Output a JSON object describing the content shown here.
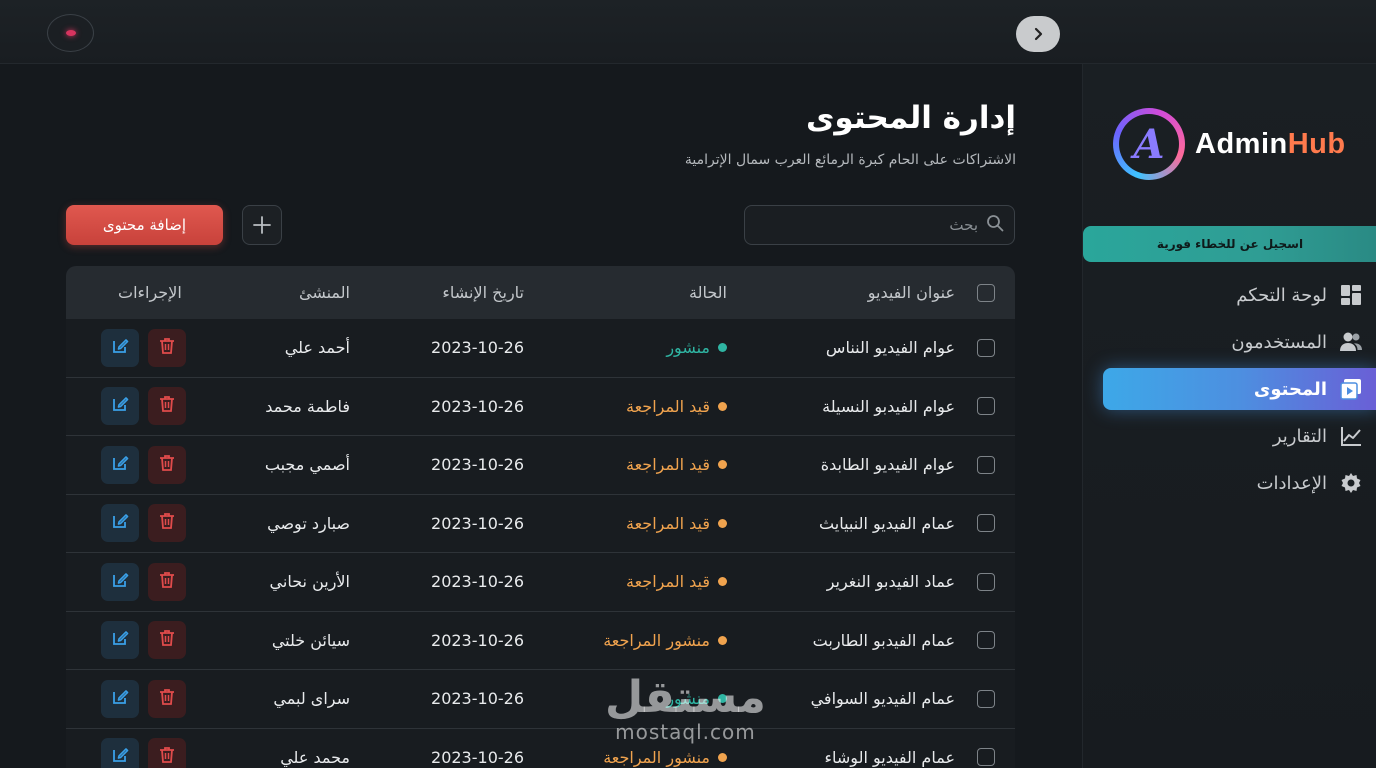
{
  "topbar": {
    "collapse_icon": "chevron-right-icon",
    "user_icon": "user-chip-icon"
  },
  "sidebar": {
    "logo": {
      "mark": "A",
      "text_primary": "Admin",
      "text_accent": "Hub"
    },
    "promo_text": "اسجيل عن للخطاء فورية",
    "items": [
      {
        "label": "لوحة التحكم",
        "icon": "dashboard-icon",
        "active": false
      },
      {
        "label": "المستخدمون",
        "icon": "users-icon",
        "active": false
      },
      {
        "label": "المحتوى",
        "icon": "video-icon",
        "active": true
      },
      {
        "label": "التقارير",
        "icon": "chart-icon",
        "active": false
      },
      {
        "label": "الإعدادات",
        "icon": "gear-icon",
        "active": false
      }
    ]
  },
  "main": {
    "title": "إدارة المحتوى",
    "subtitle": "الاشتراكات على الحام كبرة الرمائع العرب سمال الإترامية",
    "search_placeholder": "بحث",
    "add_button_label": "إضافة محتوى",
    "table": {
      "headers": {
        "title": "عنوان الفيديو",
        "status": "الحالة",
        "date": "تاريخ الإنشاء",
        "creator": "المنشئ",
        "actions": "الإجراءات"
      },
      "rows": [
        {
          "title": "عوام الفيديو النناس",
          "status": "منشور",
          "status_type": "published",
          "date": "2023-10-26",
          "creator": "أحمد علي"
        },
        {
          "title": "عوام الفيدبو النسيلة",
          "status": "قيد المراجعة",
          "status_type": "review",
          "date": "2023-10-26",
          "creator": "فاطمة محمد"
        },
        {
          "title": "عوام الفيديو الطابدة",
          "status": "قيد المراجعة",
          "status_type": "review",
          "date": "2023-10-26",
          "creator": "أصمي مجبب"
        },
        {
          "title": "عمام الفيديو النبيايث",
          "status": "قيد المراجعة",
          "status_type": "review",
          "date": "2023-10-26",
          "creator": "صبارد توصي"
        },
        {
          "title": "عماد الفيدبو النغرير",
          "status": "قيد المراجعة",
          "status_type": "review",
          "date": "2023-10-26",
          "creator": "الأرين نحاني"
        },
        {
          "title": "عمام الفيدبو الطاربت",
          "status": "منشور المراجعة",
          "status_type": "review",
          "date": "2023-10-26",
          "creator": "سيائن خلتي"
        },
        {
          "title": "عمام الفيديو السوافي",
          "status": "منشور",
          "status_type": "published",
          "date": "2023-10-26",
          "creator": "سراى لبمي"
        },
        {
          "title": "عمام الفيديو الوشاء",
          "status": "منشور المراجعة",
          "status_type": "review",
          "date": "2023-10-26",
          "creator": "محمد علي"
        }
      ]
    }
  },
  "watermark": {
    "line1": "مستقل",
    "line2": "mostaql.com"
  },
  "colors": {
    "accent_red": "#d44c45",
    "published": "#2fb5a3",
    "review": "#f0a34e",
    "edit_blue": "#3aa0e8",
    "delete_red": "#e04b4b"
  }
}
